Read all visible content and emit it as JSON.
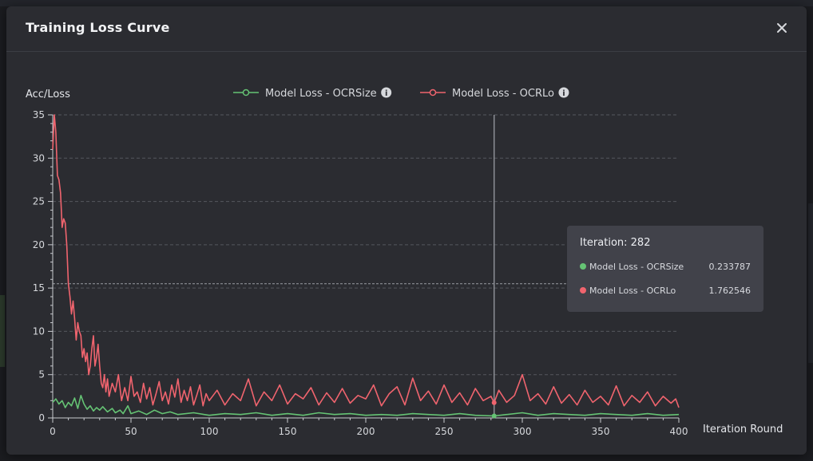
{
  "dialog": {
    "title": "Training Loss Curve",
    "close_label": "×"
  },
  "colors": {
    "green": "#65c374",
    "red": "#f0646e",
    "grid": "#5a5c63",
    "axis": "#c9cbd0"
  },
  "tooltip": {
    "title": "Iteration: 282",
    "rows": [
      {
        "name": "Model Loss - OCRSize",
        "value": "0.233787"
      },
      {
        "name": "Model Loss - OCRLo",
        "value": "1.762546"
      }
    ]
  },
  "chart_data": {
    "type": "line",
    "ylabel": "Acc/Loss",
    "xlabel": "Iteration Round",
    "xlim": [
      0,
      400
    ],
    "ylim": [
      0,
      35
    ],
    "xticks": [
      0,
      50,
      100,
      150,
      200,
      250,
      300,
      350,
      400
    ],
    "yticks": [
      0,
      5,
      10,
      15,
      20,
      25,
      30,
      35
    ],
    "reference_line_y": 15.5,
    "cursor_x": 282,
    "grid": "horizontal-dashed",
    "legend_position": "top-center",
    "series": [
      {
        "name": "Model Loss - OCRSize",
        "color": "#65c374",
        "points": [
          [
            0,
            1.8
          ],
          [
            2,
            2.2
          ],
          [
            4,
            1.6
          ],
          [
            6,
            2.0
          ],
          [
            8,
            1.2
          ],
          [
            10,
            1.8
          ],
          [
            12,
            1.4
          ],
          [
            14,
            2.3
          ],
          [
            16,
            1.1
          ],
          [
            18,
            2.6
          ],
          [
            20,
            1.6
          ],
          [
            22,
            1.0
          ],
          [
            24,
            1.4
          ],
          [
            26,
            0.8
          ],
          [
            28,
            1.2
          ],
          [
            30,
            0.9
          ],
          [
            32,
            1.3
          ],
          [
            35,
            0.7
          ],
          [
            38,
            1.1
          ],
          [
            40,
            0.6
          ],
          [
            43,
            0.9
          ],
          [
            45,
            0.5
          ],
          [
            48,
            1.4
          ],
          [
            50,
            0.5
          ],
          [
            55,
            0.8
          ],
          [
            60,
            0.4
          ],
          [
            65,
            0.9
          ],
          [
            70,
            0.5
          ],
          [
            75,
            0.7
          ],
          [
            80,
            0.4
          ],
          [
            90,
            0.6
          ],
          [
            100,
            0.3
          ],
          [
            110,
            0.5
          ],
          [
            120,
            0.4
          ],
          [
            130,
            0.6
          ],
          [
            140,
            0.3
          ],
          [
            150,
            0.5
          ],
          [
            160,
            0.3
          ],
          [
            170,
            0.6
          ],
          [
            180,
            0.4
          ],
          [
            190,
            0.5
          ],
          [
            200,
            0.3
          ],
          [
            210,
            0.4
          ],
          [
            220,
            0.3
          ],
          [
            230,
            0.5
          ],
          [
            240,
            0.4
          ],
          [
            250,
            0.3
          ],
          [
            260,
            0.5
          ],
          [
            270,
            0.3
          ],
          [
            282,
            0.23
          ],
          [
            290,
            0.4
          ],
          [
            300,
            0.6
          ],
          [
            310,
            0.3
          ],
          [
            320,
            0.5
          ],
          [
            330,
            0.4
          ],
          [
            340,
            0.3
          ],
          [
            350,
            0.5
          ],
          [
            360,
            0.4
          ],
          [
            370,
            0.3
          ],
          [
            380,
            0.5
          ],
          [
            390,
            0.3
          ],
          [
            400,
            0.4
          ]
        ]
      },
      {
        "name": "Model Loss - OCRLo",
        "color": "#f0646e",
        "points": [
          [
            0,
            31
          ],
          [
            1,
            35
          ],
          [
            2,
            33
          ],
          [
            3,
            28
          ],
          [
            4,
            27.5
          ],
          [
            5,
            26
          ],
          [
            6,
            22
          ],
          [
            7,
            23
          ],
          [
            8,
            22.5
          ],
          [
            9,
            20
          ],
          [
            10,
            15.5
          ],
          [
            11,
            14
          ],
          [
            12,
            12
          ],
          [
            13,
            13.5
          ],
          [
            14,
            11.5
          ],
          [
            15,
            9
          ],
          [
            16,
            11
          ],
          [
            17,
            10
          ],
          [
            18,
            9.5
          ],
          [
            19,
            7
          ],
          [
            20,
            8
          ],
          [
            21,
            6.5
          ],
          [
            22,
            7.5
          ],
          [
            23,
            5
          ],
          [
            24,
            6
          ],
          [
            25,
            8
          ],
          [
            26,
            9.5
          ],
          [
            27,
            6
          ],
          [
            28,
            7
          ],
          [
            29,
            8.5
          ],
          [
            30,
            6
          ],
          [
            31,
            4
          ],
          [
            32,
            3.5
          ],
          [
            33,
            5
          ],
          [
            34,
            3
          ],
          [
            35,
            4.5
          ],
          [
            36,
            2.5
          ],
          [
            38,
            4
          ],
          [
            40,
            3
          ],
          [
            42,
            5
          ],
          [
            44,
            2
          ],
          [
            46,
            3.5
          ],
          [
            48,
            2
          ],
          [
            50,
            4.8
          ],
          [
            52,
            2.5
          ],
          [
            54,
            3
          ],
          [
            56,
            1.8
          ],
          [
            58,
            4
          ],
          [
            60,
            2.2
          ],
          [
            62,
            3.5
          ],
          [
            64,
            1.5
          ],
          [
            66,
            2.8
          ],
          [
            68,
            4.2
          ],
          [
            70,
            2
          ],
          [
            72,
            3
          ],
          [
            74,
            1.6
          ],
          [
            76,
            3.8
          ],
          [
            78,
            2.4
          ],
          [
            80,
            4.5
          ],
          [
            82,
            1.8
          ],
          [
            84,
            3.2
          ],
          [
            86,
            2
          ],
          [
            88,
            3.6
          ],
          [
            90,
            1.5
          ],
          [
            92,
            2.6
          ],
          [
            94,
            3.8
          ],
          [
            96,
            1.4
          ],
          [
            98,
            2.8
          ],
          [
            100,
            2
          ],
          [
            105,
            3.2
          ],
          [
            110,
            1.5
          ],
          [
            115,
            2.8
          ],
          [
            120,
            2
          ],
          [
            125,
            4.5
          ],
          [
            130,
            1.4
          ],
          [
            135,
            3
          ],
          [
            140,
            2
          ],
          [
            145,
            3.8
          ],
          [
            150,
            1.6
          ],
          [
            155,
            2.8
          ],
          [
            160,
            2.2
          ],
          [
            165,
            3.5
          ],
          [
            170,
            1.5
          ],
          [
            175,
            2.9
          ],
          [
            180,
            1.8
          ],
          [
            185,
            3.4
          ],
          [
            190,
            1.7
          ],
          [
            195,
            2.6
          ],
          [
            200,
            2.2
          ],
          [
            205,
            3.8
          ],
          [
            210,
            1.4
          ],
          [
            215,
            2.8
          ],
          [
            220,
            3.6
          ],
          [
            225,
            1.5
          ],
          [
            230,
            4.6
          ],
          [
            235,
            2
          ],
          [
            240,
            3.1
          ],
          [
            245,
            1.6
          ],
          [
            250,
            3.8
          ],
          [
            255,
            1.8
          ],
          [
            260,
            2.9
          ],
          [
            265,
            1.5
          ],
          [
            270,
            3.4
          ],
          [
            275,
            2
          ],
          [
            280,
            2.5
          ],
          [
            282,
            1.76
          ],
          [
            285,
            3.2
          ],
          [
            290,
            1.8
          ],
          [
            295,
            2.6
          ],
          [
            300,
            5
          ],
          [
            305,
            2
          ],
          [
            310,
            2.8
          ],
          [
            315,
            1.6
          ],
          [
            320,
            3.6
          ],
          [
            325,
            1.7
          ],
          [
            330,
            2.7
          ],
          [
            335,
            1.5
          ],
          [
            340,
            3.2
          ],
          [
            345,
            1.8
          ],
          [
            350,
            2.5
          ],
          [
            355,
            1.5
          ],
          [
            360,
            3.7
          ],
          [
            365,
            1.4
          ],
          [
            370,
            2.6
          ],
          [
            375,
            1.8
          ],
          [
            380,
            3
          ],
          [
            385,
            1.4
          ],
          [
            390,
            2.5
          ],
          [
            395,
            1.7
          ],
          [
            398,
            2.2
          ],
          [
            400,
            1.2
          ]
        ]
      }
    ]
  }
}
